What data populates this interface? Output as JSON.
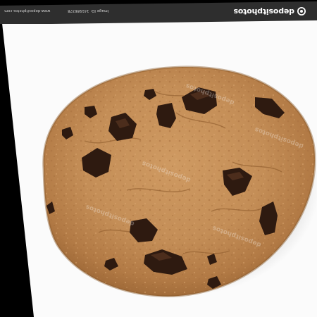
{
  "stock_header": {
    "brand_name": "depositphotos",
    "image_id_text": "Image ID: 141986378",
    "site_text": "www.depositphotos.com",
    "background_color": "#2e2e2e"
  },
  "photo": {
    "subject": "chocolate chip cookie",
    "watermark_text": "depositphotos",
    "icons": [
      "depositphotos-logo-icon"
    ]
  },
  "colors": {
    "paper": "#fbfbfb",
    "frame": "#000000",
    "cookie_dough": "#c48e57",
    "chocolate_chip": "#2e1a10"
  }
}
